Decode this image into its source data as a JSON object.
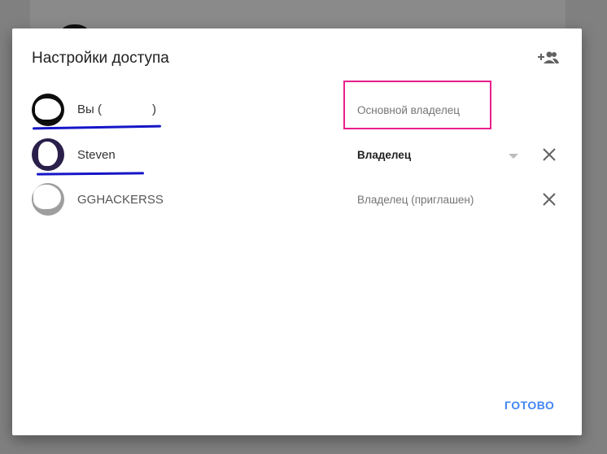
{
  "dialog": {
    "title": "Настройки доступа",
    "add_icon": "person-add-icon",
    "done_label": "ГОТОВО",
    "accent_color": "#4285f4",
    "highlight_color": "#e91e8c",
    "annotation_color": "#1515c8"
  },
  "people": [
    {
      "name": "Вы (",
      "name_suffix": ")",
      "role": "Основной владелец",
      "removable": false
    },
    {
      "name": "Steven",
      "role": "Владелец",
      "has_dropdown": true,
      "removable": true
    },
    {
      "name": "GGHACKERSS",
      "role": "Владелец (приглашен)",
      "removable": true
    }
  ]
}
